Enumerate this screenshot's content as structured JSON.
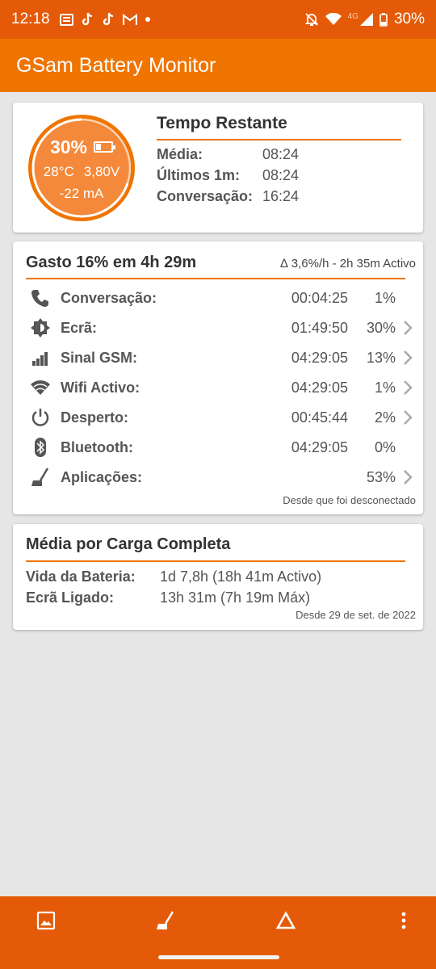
{
  "status_bar": {
    "time": "12:18",
    "battery_percent": "30%",
    "network": "4G"
  },
  "app_title": "GSam Battery Monitor",
  "gauge": {
    "percent": "30%",
    "temperature": "28°C",
    "voltage": "3,80V",
    "current": "-22 mA",
    "level": 0.3
  },
  "time_remaining": {
    "title": "Tempo Restante",
    "rows": [
      {
        "label": "Média:",
        "value": "08:24"
      },
      {
        "label": "Últimos 1m:",
        "value": "08:24"
      },
      {
        "label": "Conversação:",
        "value": "16:24"
      }
    ]
  },
  "usage": {
    "title": "Gasto 16% em 4h 29m",
    "subtitle": "∆ 3,6%/h - 2h 35m Activo",
    "rows": [
      {
        "icon": "phone-icon",
        "label": "Conversação:",
        "time": "00:04:25",
        "percent": "1%",
        "has_chevron": false
      },
      {
        "icon": "screen-icon",
        "label": "Ecrã:",
        "time": "01:49:50",
        "percent": "30%",
        "has_chevron": true
      },
      {
        "icon": "signal-icon",
        "label": "Sinal GSM:",
        "time": "04:29:05",
        "percent": "13%",
        "has_chevron": true
      },
      {
        "icon": "wifi-icon",
        "label": "Wifi Activo:",
        "time": "04:29:05",
        "percent": "1%",
        "has_chevron": true
      },
      {
        "icon": "power-icon",
        "label": "Desperto:",
        "time": "00:45:44",
        "percent": "2%",
        "has_chevron": true
      },
      {
        "icon": "bluetooth-icon",
        "label": "Bluetooth:",
        "time": "04:29:05",
        "percent": "0%",
        "has_chevron": false
      },
      {
        "icon": "broom-icon",
        "label": "Aplicações:",
        "time": "",
        "percent": "53%",
        "has_chevron": true
      }
    ],
    "footer": "Desde que foi desconectado"
  },
  "full_charge": {
    "title": "Média por Carga Completa",
    "rows": [
      {
        "label": "Vida da Bateria:",
        "value": "1d 7,8h (18h 41m Activo)"
      },
      {
        "label": "Ecrã Ligado:",
        "value": "13h 31m (7h 19m Máx)"
      }
    ],
    "footer": "Desde 29 de set. de 2022"
  },
  "colors": {
    "accent": "#ef7400",
    "status_bar": "#e45a08",
    "gauge_fill": "#f4893b"
  }
}
